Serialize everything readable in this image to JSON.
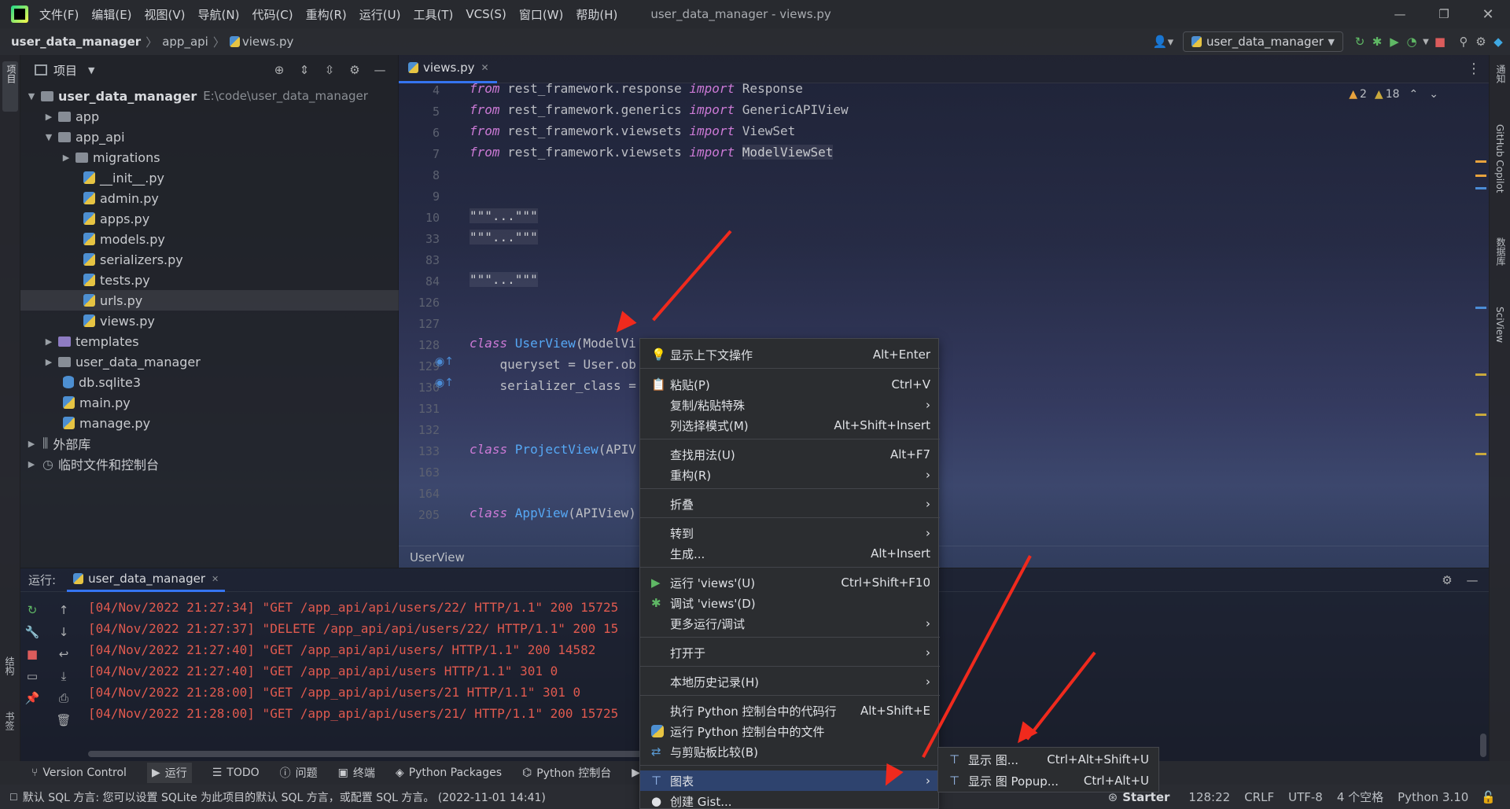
{
  "titlebar": {
    "menus": [
      "文件(F)",
      "编辑(E)",
      "视图(V)",
      "导航(N)",
      "代码(C)",
      "重构(R)",
      "运行(U)",
      "工具(T)",
      "VCS(S)",
      "窗口(W)",
      "帮助(H)"
    ],
    "title": "user_data_manager - views.py"
  },
  "navbar": {
    "crumbs": [
      "user_data_manager",
      "app_api",
      "views.py"
    ],
    "run_config": "user_data_manager"
  },
  "project": {
    "header": "项目",
    "root": "user_data_manager",
    "root_path": "E:\\code\\user_data_manager",
    "items": [
      "app",
      "app_api",
      "migrations",
      "__init__.py",
      "admin.py",
      "apps.py",
      "models.py",
      "serializers.py",
      "tests.py",
      "urls.py",
      "views.py",
      "templates",
      "user_data_manager",
      "db.sqlite3",
      "main.py",
      "manage.py",
      "外部库",
      "临时文件和控制台"
    ]
  },
  "editor": {
    "tab": "views.py",
    "warn_count": "2",
    "weak_count": "18",
    "breadcrumb": "UserView",
    "line_nums": [
      "4",
      "5",
      "6",
      "7",
      "8",
      "9",
      "10",
      "33",
      "83",
      "84",
      "126",
      "127",
      "128",
      "129",
      "130",
      "131",
      "132",
      "133",
      "163",
      "164",
      "205"
    ],
    "lines": {
      "l4a": "from ",
      "l4b": "rest_framework.response ",
      "l4c": "import ",
      "l4d": "Response",
      "l5a": "from ",
      "l5b": "rest_framework.generics ",
      "l5c": "import ",
      "l5d": "GenericAPIView",
      "l6a": "from ",
      "l6b": "rest_framework.viewsets ",
      "l6c": "import ",
      "l6d": "ViewSet",
      "l7a": "from ",
      "l7b": "rest_framework.viewsets ",
      "l7c": "import ",
      "l7d": "ModelViewSet",
      "fold": "\"\"\"...\"\"\"",
      "l128a": "class ",
      "l128b": "UserView",
      "l128c": "(ModelVi",
      "l129": "    queryset = User.ob",
      "l130": "    serializer_class = ",
      "l133a": "class ",
      "l133b": "ProjectView",
      "l133c": "(APIV",
      "l205a": "class ",
      "l205b": "AppView",
      "l205c": "(APIView)"
    }
  },
  "run": {
    "label": "运行:",
    "tab": "user_data_manager",
    "logs": [
      "[04/Nov/2022 21:27:34] \"GET /app_api/api/users/22/ HTTP/1.1\" 200 15725",
      "[04/Nov/2022 21:27:37] \"DELETE /app_api/api/users/22/ HTTP/1.1\" 200 15",
      "[04/Nov/2022 21:27:40] \"GET /app_api/api/users/ HTTP/1.1\" 200 14582",
      "[04/Nov/2022 21:27:40] \"GET /app_api/api/users HTTP/1.1\" 301 0",
      "[04/Nov/2022 21:28:00] \"GET /app_api/api/users/21 HTTP/1.1\" 301 0",
      "[04/Nov/2022 21:28:00] \"GET /app_api/api/users/21/ HTTP/1.1\" 200 15725"
    ]
  },
  "bottom": {
    "items": [
      "Version Control",
      "运行",
      "TODO",
      "问题",
      "终端",
      "Python Packages",
      "Python 控制台",
      "服"
    ]
  },
  "status": {
    "message": "默认 SQL 方言: 您可以设置 SQLite 为此项目的默认 SQL 方言，或配置 SQL 方言。 (2022-11-01 14:41)",
    "plugin": "Starter",
    "pos": "128:22",
    "eol": "CRLF",
    "enc": "UTF-8",
    "indent": "4 个空格",
    "interp": "Python 3.10"
  },
  "ctx": {
    "items": [
      {
        "label": "显示上下文操作",
        "sc": "Alt+Enter"
      },
      {
        "label": "粘贴(P)",
        "sc": "Ctrl+V"
      },
      {
        "label": "复制/粘贴特殊",
        "sc": ""
      },
      {
        "label": "列选择模式(M)",
        "sc": "Alt+Shift+Insert"
      },
      {
        "label": "查找用法(U)",
        "sc": "Alt+F7"
      },
      {
        "label": "重构(R)",
        "sc": ""
      },
      {
        "label": "折叠",
        "sc": ""
      },
      {
        "label": "转到",
        "sc": ""
      },
      {
        "label": "生成...",
        "sc": "Alt+Insert"
      },
      {
        "label": "运行 'views'(U)",
        "sc": "Ctrl+Shift+F10"
      },
      {
        "label": "调试 'views'(D)",
        "sc": ""
      },
      {
        "label": "更多运行/调试",
        "sc": ""
      },
      {
        "label": "打开于",
        "sc": ""
      },
      {
        "label": "本地历史记录(H)",
        "sc": ""
      },
      {
        "label": "执行 Python 控制台中的代码行",
        "sc": "Alt+Shift+E"
      },
      {
        "label": "运行 Python 控制台中的文件",
        "sc": ""
      },
      {
        "label": "与剪贴板比较(B)",
        "sc": ""
      },
      {
        "label": "图表",
        "sc": ""
      },
      {
        "label": "创建 Gist...",
        "sc": ""
      }
    ]
  },
  "submenu": {
    "items": [
      {
        "label": "显示 图...",
        "sc": "Ctrl+Alt+Shift+U"
      },
      {
        "label": "显示 图 Popup...",
        "sc": "Ctrl+Alt+U"
      }
    ]
  },
  "right_tabs": [
    "通知",
    "GitHub Copilot",
    "数据库",
    "SciView"
  ],
  "left_tabs": [
    "项目",
    "结构",
    "书签"
  ]
}
